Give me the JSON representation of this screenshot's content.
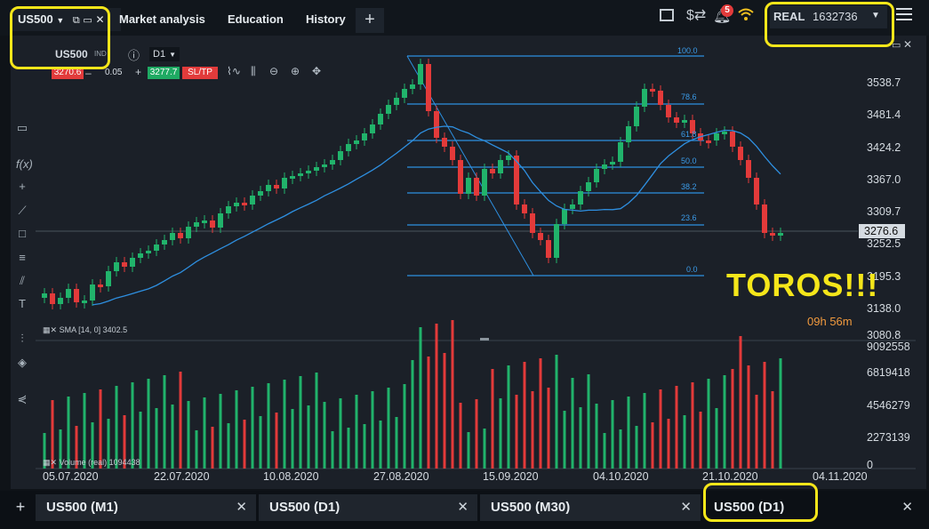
{
  "tabs": {
    "symbol": "US500",
    "market_analysis": "Market analysis",
    "education": "Education",
    "history": "History"
  },
  "header": {
    "notification_count": "5",
    "account_mode": "REAL",
    "balance": "1632736"
  },
  "instrument": {
    "name": "US500",
    "tag": "IND",
    "timeframe": "D1",
    "sell_price": "3270.6",
    "lot": "0.05",
    "buy_price": "3277.7",
    "sltp_label": "SL/TP"
  },
  "price_axis": [
    "3538.7",
    "3481.4",
    "3424.2",
    "3367.0",
    "3309.7",
    "3252.5",
    "3195.3",
    "3138.0",
    "3080.8"
  ],
  "current_price": "3276.6",
  "volume_axis": [
    "9092558",
    "6819418",
    "4546279",
    "2273139",
    "0"
  ],
  "date_axis": [
    "05.07.2020",
    "22.07.2020",
    "10.08.2020",
    "27.08.2020",
    "15.09.2020",
    "04.10.2020",
    "21.10.2020",
    "04.11.2020"
  ],
  "fib_levels": [
    "100.0",
    "78.6",
    "61.8",
    "50.0",
    "38.2",
    "23.6",
    "0.0"
  ],
  "sma_label": "SMA [14, 0] 3402.5",
  "volume_label": "Volume (real) 1094438",
  "annotation": "TOROS!!!",
  "countdown": {
    "hours": "09h",
    "minutes": "56m"
  },
  "bottom_tabs": [
    "US500 (M1)",
    "US500 (D1)",
    "US500 (M30)",
    "US500 (D1)"
  ],
  "colors": {
    "up": "#21b36b",
    "down": "#e33a3a",
    "sma": "#2e8fe0",
    "fib": "#2e8fe0",
    "highlight": "#f5e61a"
  }
}
